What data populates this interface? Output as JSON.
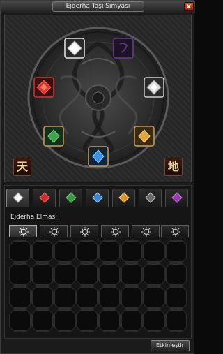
{
  "window": {
    "title": "Ejderha Taşı Simyası",
    "close_label": "x"
  },
  "seals": {
    "heaven": "天",
    "earth": "地"
  },
  "slots": [
    {
      "name": "slot-diamond-top",
      "color": "#e8e8e8",
      "filled": true
    },
    {
      "name": "slot-amethyst",
      "color": "#6a3d8a",
      "filled": false
    },
    {
      "name": "slot-ruby",
      "color": "#d8332e",
      "filled": true
    },
    {
      "name": "slot-onyx",
      "color": "#cfcfcf",
      "filled": true
    },
    {
      "name": "slot-jade",
      "color": "#3aa84a",
      "filled": true
    },
    {
      "name": "slot-topaz",
      "color": "#e0a43a",
      "filled": true
    },
    {
      "name": "slot-sapphire",
      "color": "#3a8fe0",
      "filled": true
    }
  ],
  "tabs": [
    {
      "name": "tab-diamond",
      "color": "#e8e8e8",
      "active": true
    },
    {
      "name": "tab-ruby",
      "color": "#c8302c",
      "active": false
    },
    {
      "name": "tab-jade",
      "color": "#3a9a44",
      "active": false
    },
    {
      "name": "tab-sapphire",
      "color": "#3a84d0",
      "active": false
    },
    {
      "name": "tab-topaz",
      "color": "#d8962e",
      "active": false
    },
    {
      "name": "tab-onyx",
      "color": "#8a8a8a",
      "active": false
    },
    {
      "name": "tab-amethyst",
      "color": "#9a3ab0",
      "active": false
    }
  ],
  "section": {
    "label": "Ejderha Elması"
  },
  "grades": [
    {
      "name": "grade-1",
      "active": true
    },
    {
      "name": "grade-2",
      "active": false
    },
    {
      "name": "grade-3",
      "active": false
    },
    {
      "name": "grade-4",
      "active": false
    },
    {
      "name": "grade-5",
      "active": false
    },
    {
      "name": "grade-6",
      "active": false
    }
  ],
  "inventory": {
    "rows": 4,
    "cols": 8
  },
  "actions": {
    "activate_label": "Etkinleştir"
  },
  "colors": {
    "accent": "#e8d4a0",
    "gold": "#c8a060"
  }
}
